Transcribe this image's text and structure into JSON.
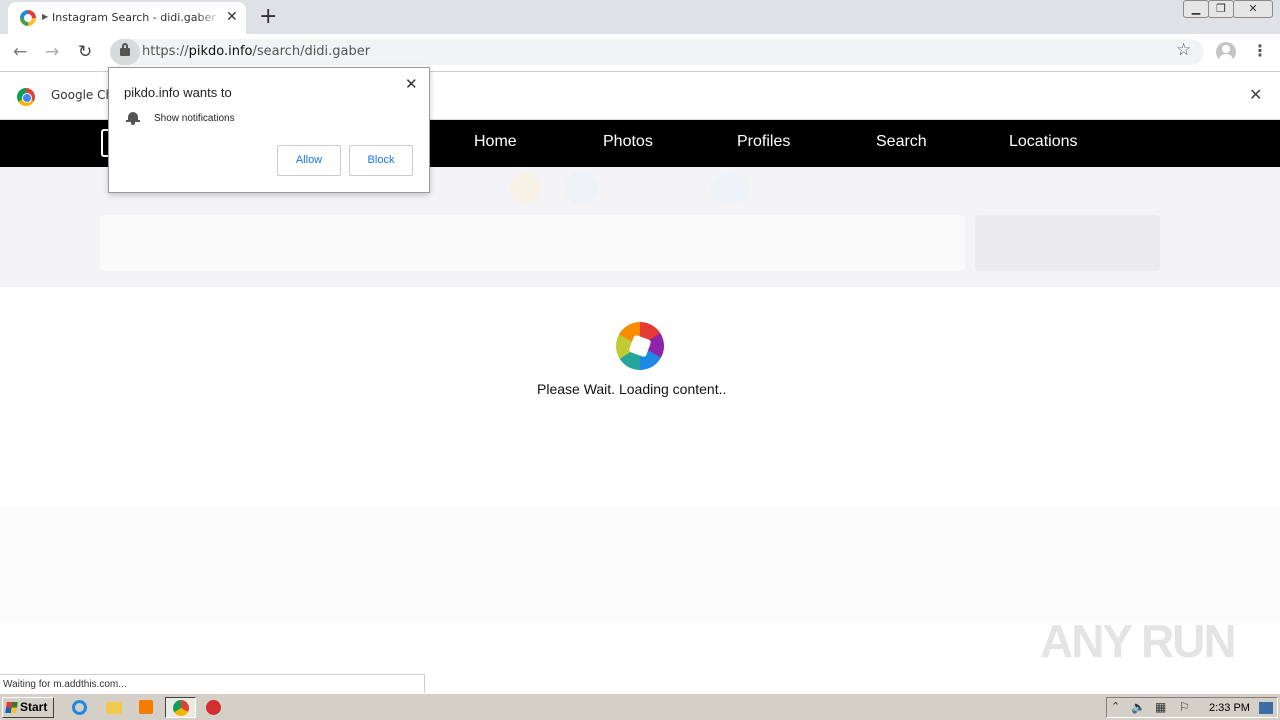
{
  "browser": {
    "tab": {
      "title": "Instagram Search - didi.gaber - Search"
    },
    "omnibox": {
      "scheme": "https://",
      "host": "pikdo.info",
      "path": "/search/didi.gaber"
    },
    "infobar": {
      "text": "Google Ch"
    },
    "status": "Waiting for m.addthis.com..."
  },
  "permission_prompt": {
    "title": "pikdo.info wants to",
    "permission": "Show notifications",
    "allow_label": "Allow",
    "block_label": "Block"
  },
  "site_nav": {
    "items": [
      {
        "label": "Home"
      },
      {
        "label": "Photos"
      },
      {
        "label": "Profiles"
      },
      {
        "label": "Search"
      },
      {
        "label": "Locations"
      }
    ]
  },
  "loader": {
    "text": "Please Wait. Loading content.."
  },
  "watermark": {
    "text": "ANY RUN"
  },
  "taskbar": {
    "start_label": "Start",
    "clock": "2:33 PM"
  },
  "colors": {
    "site_nav_bg": "#000000",
    "tabstrip_bg": "#dee1e6",
    "link_blue": "#1a73e8",
    "taskbar_bg": "#d4d0c8"
  },
  "icons": [
    "chrome-favicon",
    "audio-icon",
    "close-icon",
    "new-tab-icon",
    "back-icon",
    "forward-icon",
    "reload-icon",
    "lock-icon",
    "star-icon",
    "profile-icon",
    "menu-icon",
    "chrome-logo-icon",
    "bell-icon",
    "windows-flag-icon",
    "ie-icon",
    "folder-icon",
    "media-player-icon",
    "chrome-taskbar-icon",
    "opera-icon",
    "speaker-icon",
    "network-icon",
    "flag-icon"
  ]
}
